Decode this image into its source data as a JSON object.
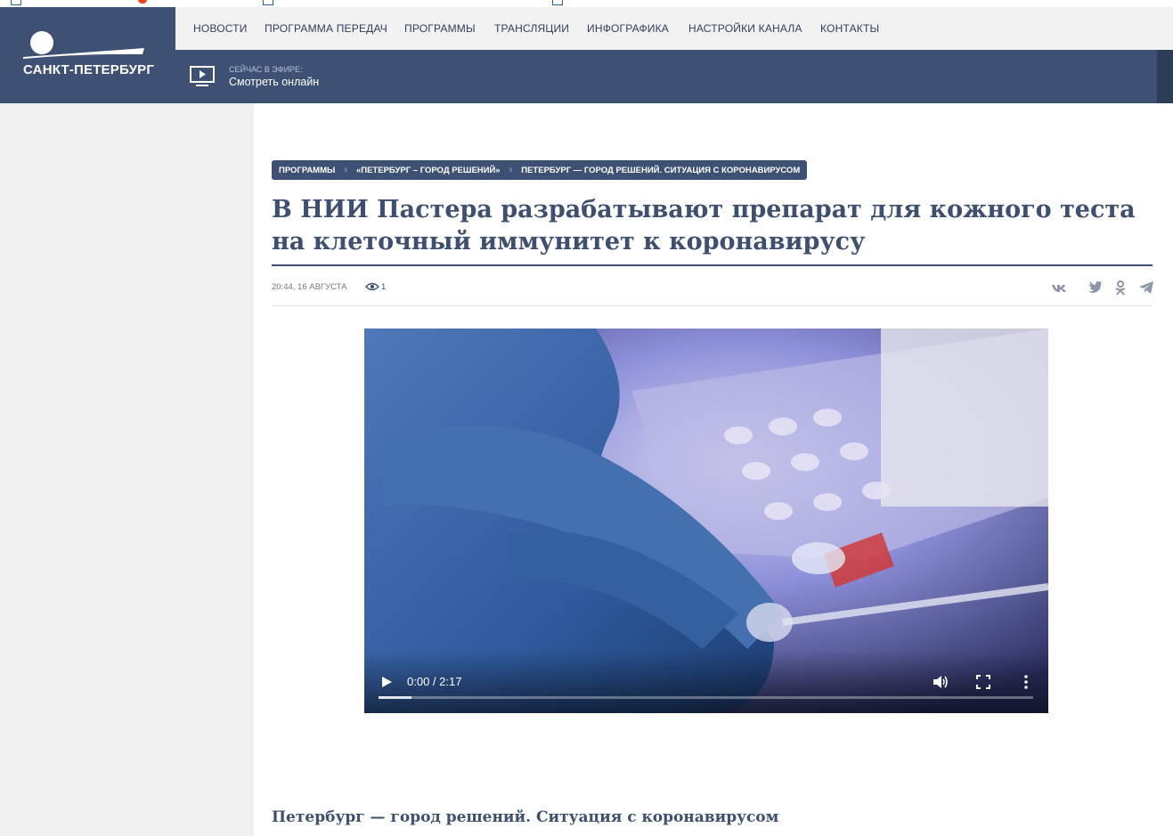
{
  "header": {
    "logo_text": "САНКТ-ПЕТЕРБУРГ",
    "nav": [
      {
        "label": "НОВОСТИ"
      },
      {
        "label": "ПРОГРАММА ПЕРЕДАЧ"
      },
      {
        "label": "ПРОГРАММЫ"
      },
      {
        "label": "ТРАНСЛЯЦИИ"
      },
      {
        "label": "ИНФОГРАФИКА"
      },
      {
        "label": "НАСТРОЙКИ КАНАЛА"
      },
      {
        "label": "КОНТАКТЫ"
      }
    ],
    "live": {
      "label": "СЕЙЧАС В ЭФИРЕ:",
      "link": "Смотреть онлайн"
    }
  },
  "article": {
    "breadcrumb": [
      "ПРОГРАММЫ",
      "«ПЕТЕРБУРГ – ГОРОД РЕШЕНИЙ»",
      "ПЕТЕРБУРГ — ГОРОД РЕШЕНИЙ. СИТУАЦИЯ С КОРОНАВИРУСОМ"
    ],
    "breadcrumb_sep": "›",
    "title": "В НИИ Пастера разрабатывают препарат для кожного теста на клеточный иммунитет к коронавирусу",
    "date": "20:44, 16 АВГУСТА",
    "views": "1",
    "share_icons": [
      "vk-icon",
      "twitter-icon",
      "odnoklassniki-icon",
      "telegram-icon"
    ],
    "program_title": "Петербург — город решений. Ситуация с коронавирусом"
  },
  "video": {
    "time": "0:00 / 2:17",
    "progress": 0.05
  },
  "colors": {
    "brand": "#3e5174",
    "headline": "#3e4f70",
    "nav_bg": "#f2f2f2",
    "side_bg": "#f0f0f0"
  }
}
